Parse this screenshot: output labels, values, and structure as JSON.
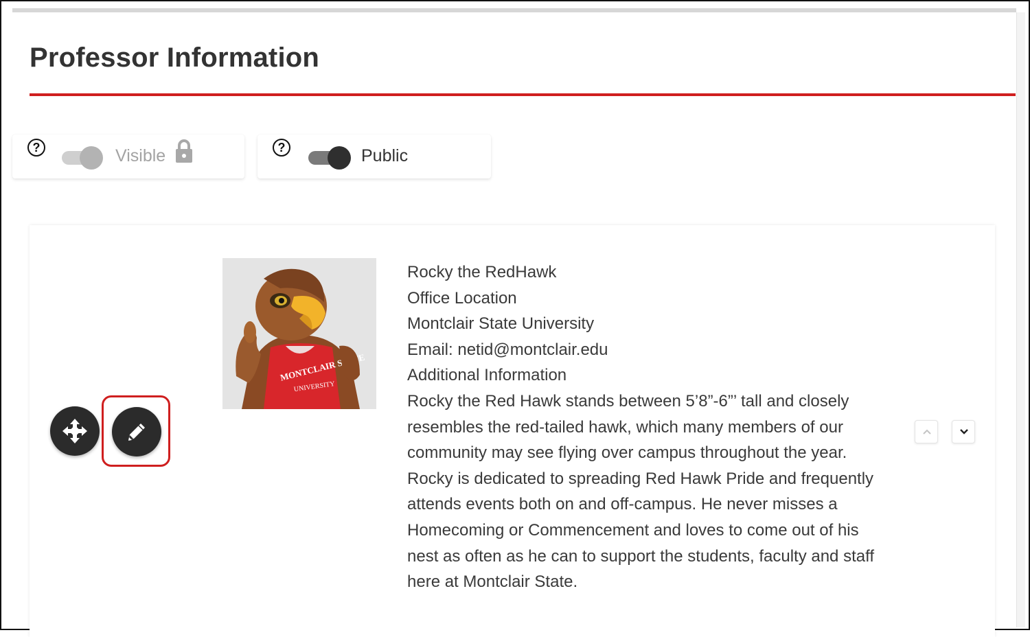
{
  "header": {
    "title": "Professor Information"
  },
  "toggles": {
    "visible": {
      "label": "Visible",
      "state": "on",
      "disabled": true,
      "help_icon": "help-circle-icon",
      "lock_icon": "lock-icon"
    },
    "public": {
      "label": "Public",
      "state": "on",
      "disabled": false,
      "help_icon": "help-circle-icon"
    }
  },
  "help_glyph": "?",
  "block": {
    "move_icon": "move-icon",
    "edit_icon": "pencil-icon",
    "photo_alt": "Rocky the RedHawk",
    "lines": [
      "Rocky the RedHawk",
      "Office Location",
      "Montclair State University",
      "Email: netid@montclair.edu",
      "Additional Information"
    ],
    "description": "Rocky the Red Hawk stands between 5’8”-6”’ tall and closely resembles the red-tailed hawk, which many members of our community may see flying over campus throughout the year. Rocky is dedicated to spreading Red Hawk Pride and frequently attends events both on and off-campus. He never misses a Homecoming or Commencement and loves to come out of his nest as often as he can to support the students, faculty and staff here at Montclair State.",
    "move_up_icon": "chevron-up-icon",
    "move_down_icon": "chevron-down-icon"
  },
  "colors": {
    "accent_red": "#cf1f1f",
    "button_dark": "#2b2b2b"
  }
}
